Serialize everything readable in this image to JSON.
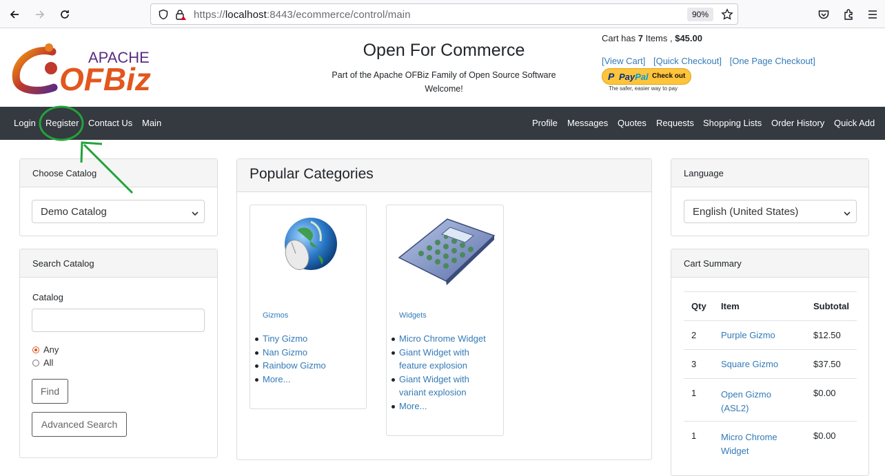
{
  "browser": {
    "url_prefix": "https://",
    "url_host": "localhost",
    "url_rest": ":8443/ecommerce/control/main",
    "zoom": "90%"
  },
  "header": {
    "logo_apache": "APACHE",
    "logo_ofbiz": "OFBiz",
    "title": "Open For Commerce",
    "subtitle": "Part of the Apache OFBiz Family of Open Source Software",
    "welcome": "Welcome!",
    "cart_prefix": "Cart has ",
    "cart_count": "7",
    "cart_mid": " Items , ",
    "cart_total": "$45.00",
    "links": [
      "[View Cart]",
      "[Quick Checkout]",
      "[One Page Checkout]"
    ],
    "paypal_p": "P",
    "paypal_brand1": "Pay",
    "paypal_brand2": "Pal",
    "paypal_checkout": "Check out",
    "paypal_tagline": "The safer, easier way to pay"
  },
  "nav": {
    "left": [
      "Login",
      "Register",
      "Contact Us",
      "Main"
    ],
    "right": [
      "Profile",
      "Messages",
      "Quotes",
      "Requests",
      "Shopping Lists",
      "Order History",
      "Quick Add"
    ]
  },
  "choose_catalog": {
    "title": "Choose Catalog",
    "selected": "Demo Catalog"
  },
  "search_catalog": {
    "title": "Search Catalog",
    "catalog_label": "Catalog",
    "input_value": "",
    "radio_any": "Any",
    "radio_all": "All",
    "find": "Find",
    "advanced": "Advanced Search"
  },
  "popular": {
    "title": "Popular Categories",
    "categories": [
      {
        "name": "Gizmos",
        "items": [
          "Tiny Gizmo",
          "Nan Gizmo",
          "Rainbow Gizmo",
          "More..."
        ]
      },
      {
        "name": "Widgets",
        "items": [
          "Micro Chrome Widget",
          "Giant Widget with",
          "feature explosion",
          "Giant Widget with",
          "variant explosion",
          "More..."
        ]
      }
    ]
  },
  "language": {
    "title": "Language",
    "selected": "English (United States)"
  },
  "cart_summary": {
    "title": "Cart Summary",
    "headers": [
      "Qty",
      "Item",
      "Subtotal"
    ],
    "rows": [
      {
        "qty": "2",
        "item": "Purple Gizmo",
        "item2": "",
        "subtotal": "$12.50"
      },
      {
        "qty": "3",
        "item": "Square Gizmo",
        "item2": "",
        "subtotal": "$37.50"
      },
      {
        "qty": "1",
        "item": "Open Gizmo",
        "item2": "(ASL2)",
        "subtotal": "$0.00"
      },
      {
        "qty": "1",
        "item": "Micro Chrome",
        "item2": "Widget",
        "subtotal": "$0.00"
      }
    ]
  },
  "colors": {
    "navbar": "#343a40",
    "link": "#337ab7",
    "annotation": "#22a33a",
    "paypal": "#ffc439"
  }
}
